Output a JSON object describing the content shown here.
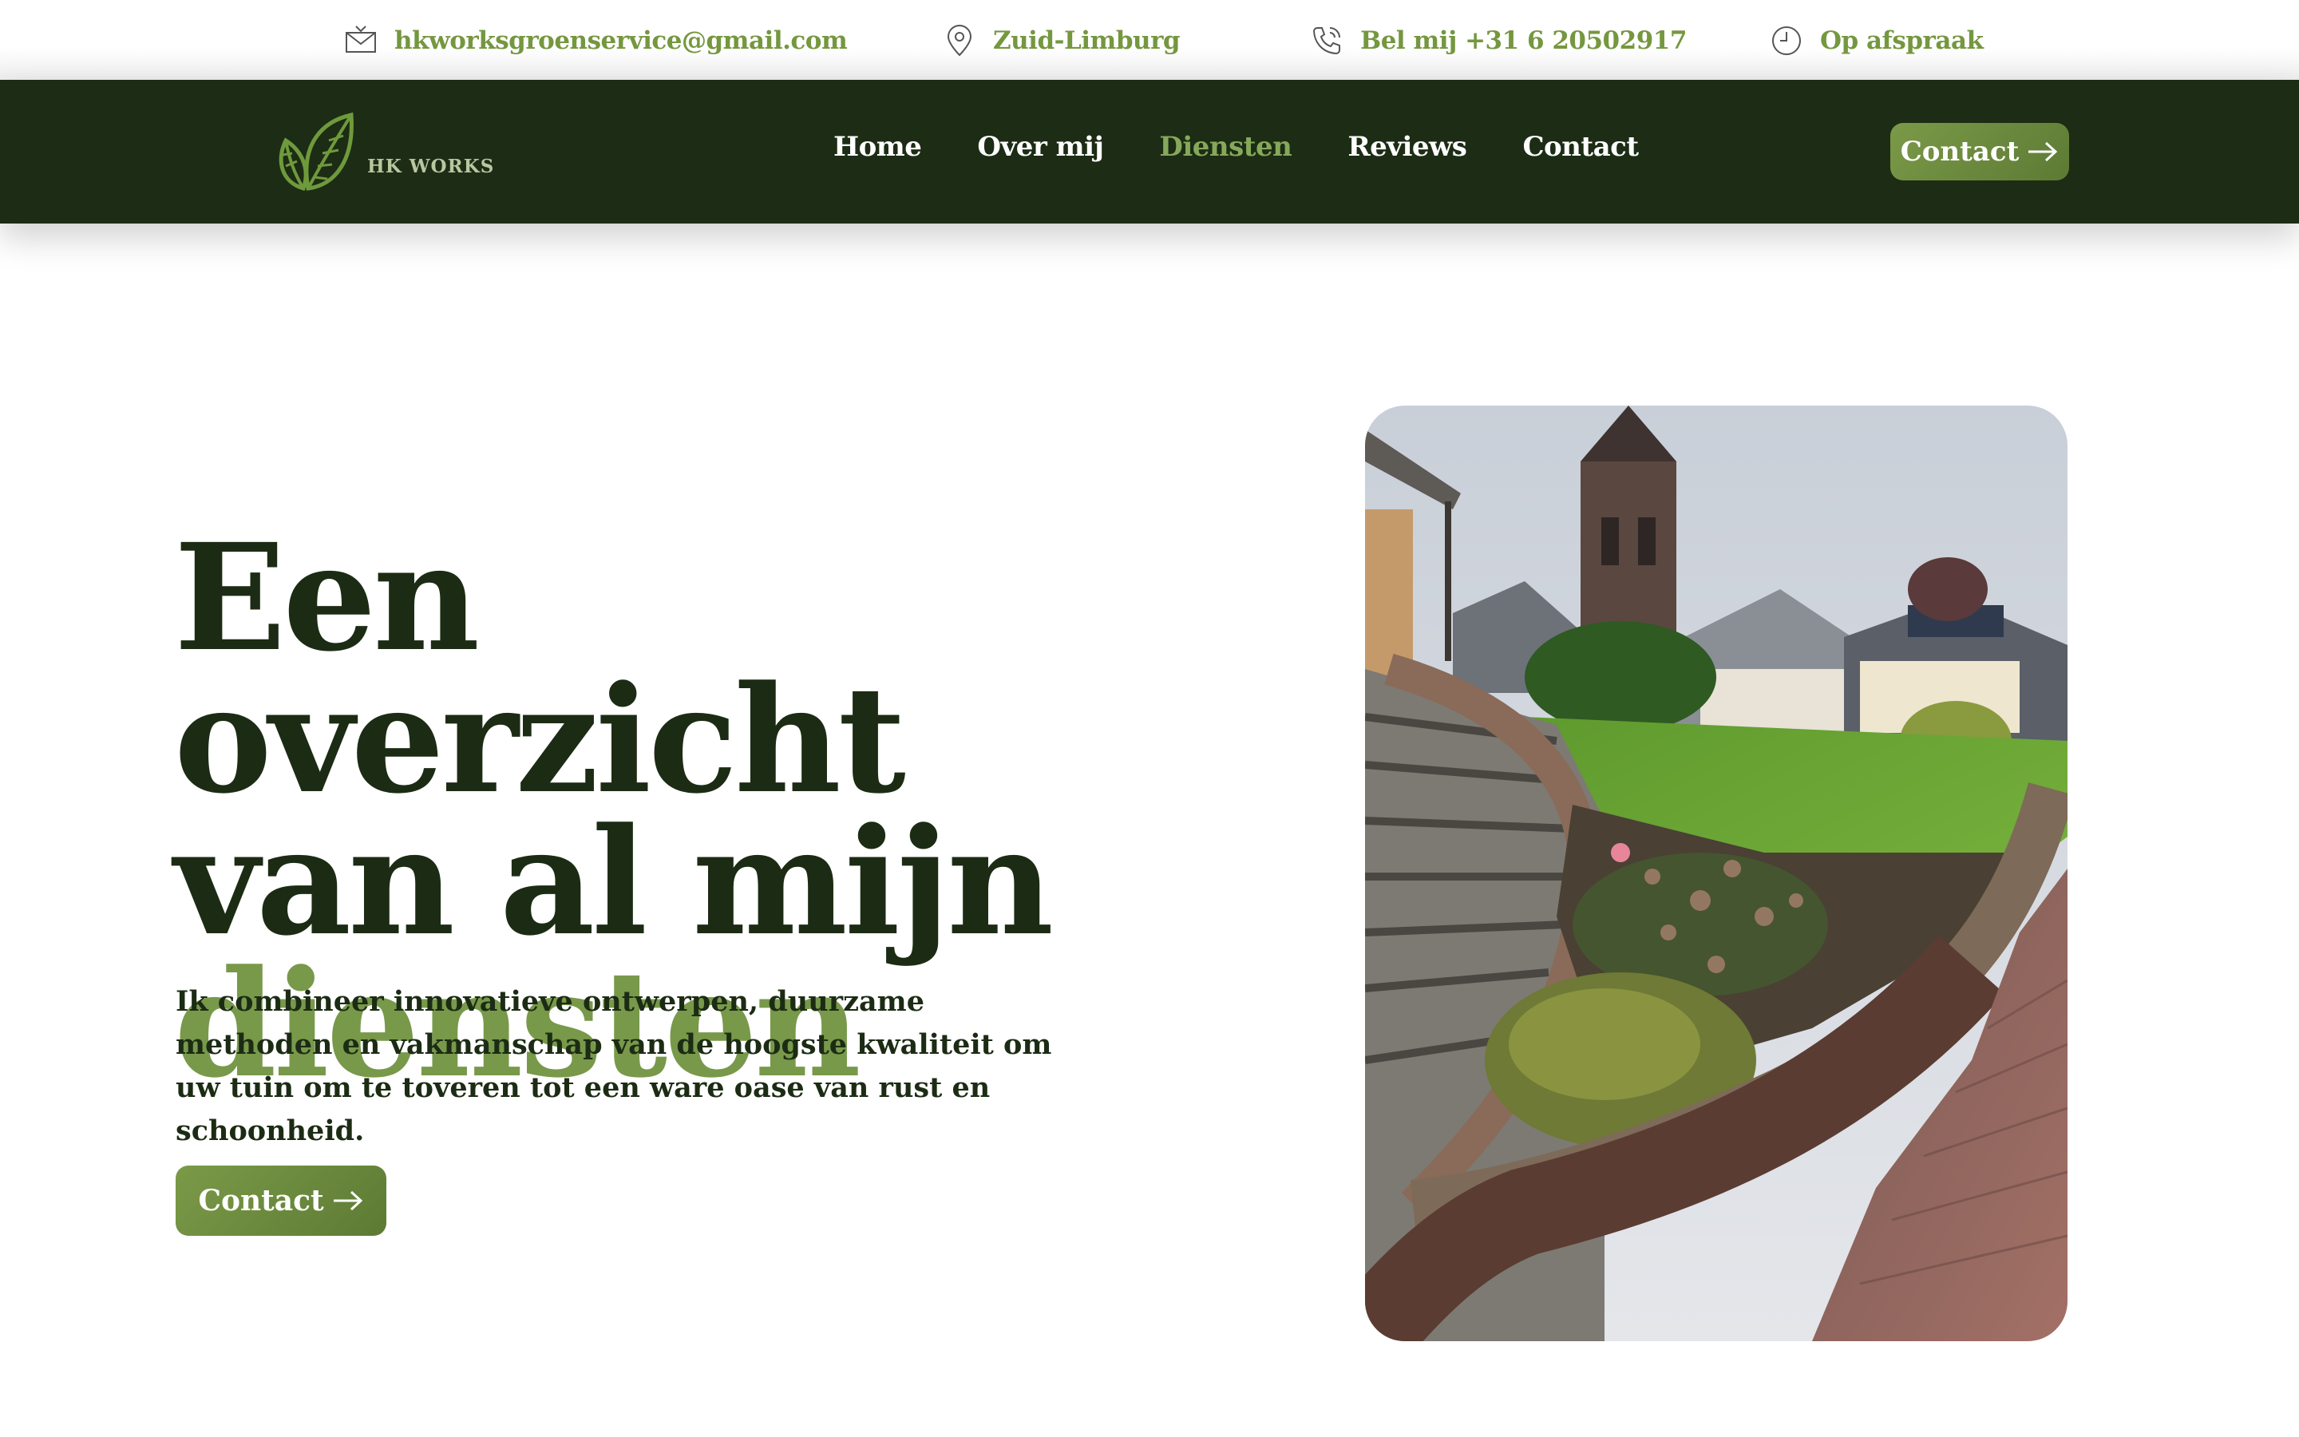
{
  "topbar": {
    "email": "hkworksgroenservice@gmail.com",
    "region": "Zuid-Limburg",
    "phone": "Bel mij +31 6 20502917",
    "hours": "Op afspraak"
  },
  "nav": {
    "logo_text": "HK WORKS",
    "items": [
      {
        "label": "Home"
      },
      {
        "label": "Over mij"
      },
      {
        "label": "Diensten"
      },
      {
        "label": "Reviews"
      },
      {
        "label": "Contact"
      }
    ],
    "active_index": 2,
    "cta_label": "Contact"
  },
  "hero": {
    "title_line1": "Een overzicht",
    "title_line2": "van al mijn",
    "title_accent": "diensten",
    "text": "Ik combineer innovatieve ontwerpen, duurzame methoden en vakmanschap van de hoogste kwaliteit om uw tuin om te toveren tot een ware oase van rust en schoonheid.",
    "cta_label": "Contact"
  },
  "colors": {
    "dark_green": "#1d2c15",
    "accent_green": "#78994a",
    "button_green": "#6c8a3f"
  },
  "icons": [
    "envelope-icon",
    "map-pin-icon",
    "phone-icon",
    "clock-icon",
    "leaf-logo-icon",
    "arrow-right-icon"
  ]
}
